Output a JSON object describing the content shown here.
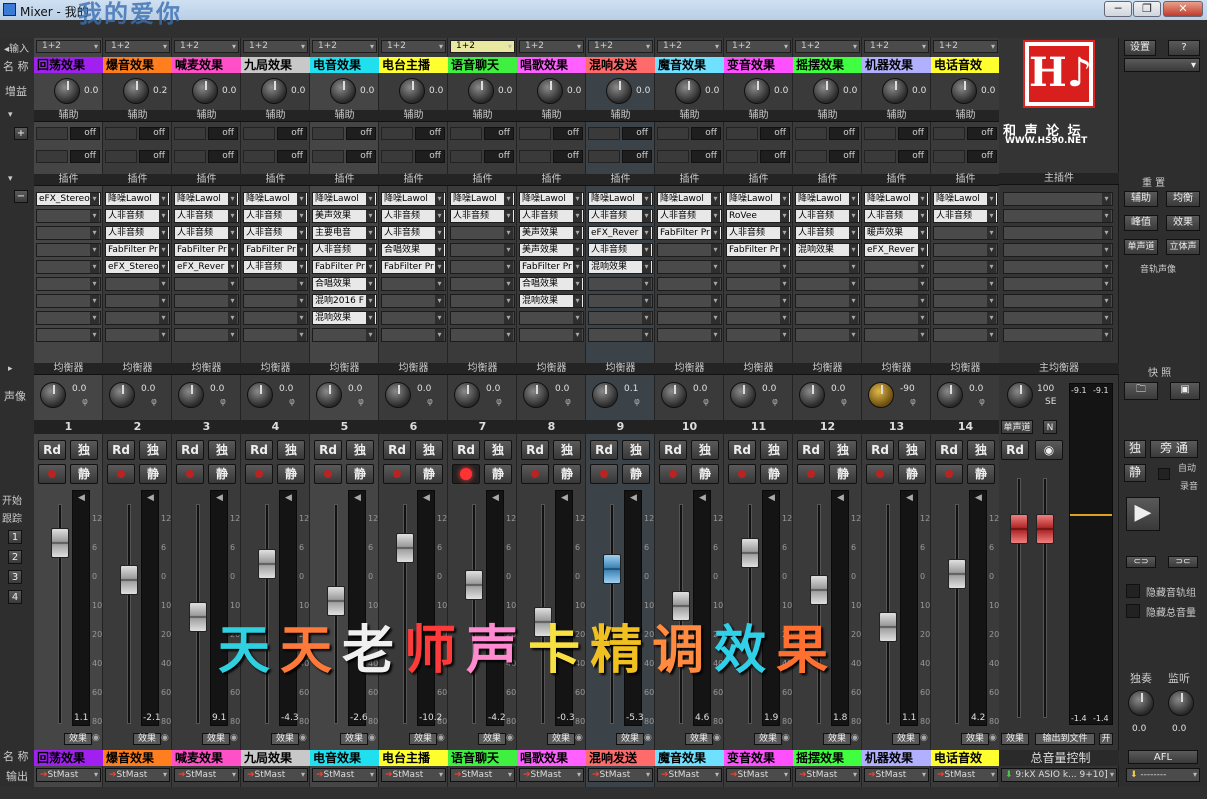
{
  "window": {
    "title": "Mixer - 我的",
    "overlay_title": "我的爱你",
    "controls": [
      "─",
      "❐",
      "✕"
    ]
  },
  "left_labels": {
    "input": "◂输入",
    "name": "名 称",
    "gain": "增益",
    "aux": "辅助",
    "inserts": "插件",
    "eq": "均衡器",
    "pan": "声像",
    "start_track": "开始",
    "track_follow": "跟踪",
    "track_buttons": [
      "1",
      "2",
      "3",
      "4"
    ],
    "bottom_name": "名 称",
    "output": "输出"
  },
  "section_labels": {
    "aux": "辅助",
    "inserts": "插件",
    "eq": "均衡器",
    "master_inserts": "主插件",
    "master_eq": "主均衡器",
    "off": "off",
    "fx": "效果",
    "solo": "独",
    "mute": "静",
    "read": "Rd",
    "input_value": "1+2",
    "output_value": "StMast"
  },
  "channels": [
    {
      "num": "1",
      "name": "回荡效果",
      "color": "#a020f0",
      "gain": "0.0",
      "pan": "0.0",
      "inserts": [
        "eFX_Stereo",
        "",
        "",
        "",
        "",
        "",
        "",
        "",
        ""
      ],
      "vol": "1.1",
      "hl": true
    },
    {
      "num": "2",
      "name": "爆音效果",
      "color": "#ff7f1f",
      "gain": "0.2",
      "pan": "0.0",
      "inserts": [
        "降噪Lawol",
        "人非音频",
        "人非音频",
        "FabFilter Pr",
        "eFX_Stereo",
        "",
        "",
        "",
        ""
      ],
      "vol": "-2.1"
    },
    {
      "num": "3",
      "name": "喊麦效果",
      "color": "#ff50c8",
      "gain": "0.0",
      "pan": "0.0",
      "inserts": [
        "降噪Lawol",
        "人非音频",
        "人非音频",
        "FabFilter Pr",
        "eFX_Rever",
        "",
        "",
        "",
        ""
      ],
      "vol": "9.1"
    },
    {
      "num": "4",
      "name": "九局效果",
      "color": "#c8c8c8",
      "gain": "0.0",
      "pan": "0.0",
      "inserts": [
        "降噪Lawol",
        "人非音频",
        "人非音频",
        "FabFilter Pr",
        "人非音频",
        "",
        "",
        "",
        ""
      ],
      "vol": "-4.3"
    },
    {
      "num": "5",
      "name": "电音效果",
      "color": "#20e0f0",
      "gain": "0.0",
      "pan": "0.0",
      "inserts": [
        "降噪Lawol",
        "美声效果",
        "主要电音",
        "人非音频",
        "FabFilter Pr",
        "合唱效果",
        "混响2016 F",
        "混响效果",
        ""
      ],
      "vol": "-2.6",
      "hl": true
    },
    {
      "num": "6",
      "name": "电台主播",
      "color": "#ffff30",
      "gain": "0.0",
      "pan": "0.0",
      "inserts": [
        "降噪Lawol",
        "人非音频",
        "人非音频",
        "合唱效果",
        "FabFilter Pr",
        "",
        "",
        "",
        ""
      ],
      "vol": "-10.2"
    },
    {
      "num": "7",
      "name": "语音聊天",
      "color": "#40f040",
      "gain": "0.0",
      "pan": "0.0",
      "inserts": [
        "降噪Lawol",
        "人非音频",
        "",
        "",
        "",
        "",
        "",
        "",
        ""
      ],
      "vol": "-4.2",
      "rec": true,
      "sel": true
    },
    {
      "num": "8",
      "name": "唱歌效果",
      "color": "#ff60ff",
      "gain": "0.0",
      "pan": "0.0",
      "inserts": [
        "降噪Lawol",
        "人非音频",
        "美声效果",
        "美声效果",
        "FabFilter Pr",
        "合唱效果",
        "混响效果",
        "",
        ""
      ],
      "vol": "-0.3"
    },
    {
      "num": "9",
      "name": "混响发送",
      "color": "#ff6a6a",
      "gain": "0.0",
      "pan": "0.1",
      "inserts": [
        "降噪Lawol",
        "人非音频",
        "eFX_Rever",
        "人非音频",
        "混响效果",
        "",
        "",
        "",
        ""
      ],
      "vol": "-5.3",
      "blue": true
    },
    {
      "num": "10",
      "name": "魔音效果",
      "color": "#70e0ff",
      "gain": "0.0",
      "pan": "0.0",
      "inserts": [
        "降噪Lawol",
        "人非音频",
        "FabFilter Pr",
        "",
        "",
        "",
        "",
        "",
        ""
      ],
      "vol": "4.6"
    },
    {
      "num": "11",
      "name": "变音效果",
      "color": "#ff50ff",
      "gain": "0.0",
      "pan": "0.0",
      "inserts": [
        "降噪Lawol",
        "RoVee",
        "人非音频",
        "FabFilter Pr",
        "",
        "",
        "",
        "",
        ""
      ],
      "vol": "1.9"
    },
    {
      "num": "12",
      "name": "摇摆效果",
      "color": "#40ff40",
      "gain": "0.0",
      "pan": "0.0",
      "inserts": [
        "降噪Lawol",
        "人非音频",
        "人非音频",
        "混响效果",
        "",
        "",
        "",
        "",
        ""
      ],
      "vol": "1.8"
    },
    {
      "num": "13",
      "name": "机器效果",
      "color": "#b0b0ff",
      "gain": "0.0",
      "pan": "-90",
      "inserts": [
        "降噪Lawol",
        "人非音频",
        "暖声效果",
        "eFX_Rever",
        "",
        "",
        "",
        "",
        ""
      ],
      "vol": "1.1",
      "goldpan": true
    },
    {
      "num": "14",
      "name": "电话音效",
      "color": "#ffff30",
      "gain": "0.0",
      "pan": "0.0",
      "inserts": [
        "降噪Lawol",
        "人非音频",
        "",
        "",
        "",
        "",
        "",
        "",
        ""
      ],
      "vol": "4.2"
    }
  ],
  "master": {
    "logo_title": "和 声 论 坛",
    "logo_url": "WWW.HS90.NET",
    "mono_label": "单声道",
    "n_label": "N",
    "pan_value": "100",
    "pan_mode": "SE",
    "meter_peak_l": "-9.1",
    "meter_peak_r": "-9.1",
    "meter_bot_l": "-1.4",
    "meter_bot_r": "-1.4",
    "export_label": "输出到文件",
    "fx_label": "效果",
    "on_label": "开",
    "bottom_name": "总音量控制",
    "output": "9:kX ASIO k... 9+10]"
  },
  "right_panel": {
    "settings": "设置",
    "help": "?",
    "reset": "重 置",
    "aux": "辅助",
    "eq": "均衡",
    "peak": "峰值",
    "fx": "效果",
    "mono": "单声道",
    "stereo": "立体声",
    "track_image": "音轨声像",
    "snapshot": "快 照",
    "solo": "独",
    "bypass": "旁 通",
    "mute": "静",
    "auto": "自动",
    "rec": "录音",
    "hide_tracks": "隐藏音轨组",
    "hide_master": "隐藏总音量",
    "solo_label": "独奏",
    "listen_label": "监听",
    "solo_val": "0.0",
    "listen_val": "0.0",
    "afl": "AFL",
    "bottom_select": "--------"
  },
  "fader_scale": [
    "12",
    "6",
    "0",
    "10",
    "20",
    "40",
    "60",
    "80"
  ],
  "overlay": {
    "chars": [
      {
        "c": "天",
        "color": "#2fd0e0"
      },
      {
        "c": "天",
        "color": "#ff7a3a"
      },
      {
        "c": "老",
        "color": "#f0f0f0"
      },
      {
        "c": "师",
        "color": "#ff3a3a"
      },
      {
        "c": "声",
        "color": "#ff8ad0"
      },
      {
        "c": "卡",
        "color": "#f7e040"
      },
      {
        "c": "精",
        "color": "#f0c020"
      },
      {
        "c": "调",
        "color": "#ff8a40"
      },
      {
        "c": "效",
        "color": "#30d0e8"
      },
      {
        "c": "果",
        "color": "#ff7030"
      }
    ]
  }
}
